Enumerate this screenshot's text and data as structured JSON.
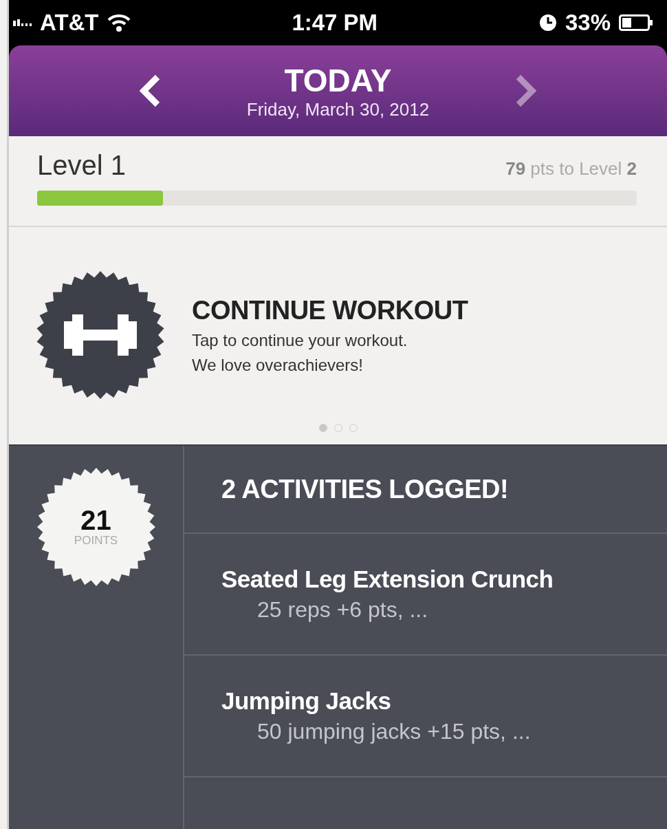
{
  "status_bar": {
    "carrier": "AT&T",
    "time": "1:47 PM",
    "battery": "33%"
  },
  "header": {
    "title": "TODAY",
    "date": "Friday, March 30, 2012",
    "prev": {
      "disabled": false
    },
    "next": {
      "disabled": true
    }
  },
  "level": {
    "label": "Level 1",
    "progress": "**79** pts to Level **2**",
    "level": 0.21
  },
  "card": {
    "title": "CONTINUE WORKOUT",
    "lines": [
      "Tap to continue your workout.",
      "We love overachievers!"
    ],
    "pages": [
      {
        "selected": true
      },
      {
        "selected": false
      },
      {
        "selected": false
      }
    ]
  },
  "summary": {
    "points": "21",
    "points_label": "POINTS",
    "heading": "2 ACTIVITIES LOGGED!",
    "activities": [
      {
        "name": "Seated Leg Extension Crunch",
        "detail": "25 reps +6 pts, ..."
      },
      {
        "name": "Jumping Jacks",
        "detail": "50 jumping jacks +15 pts, ..."
      }
    ]
  }
}
